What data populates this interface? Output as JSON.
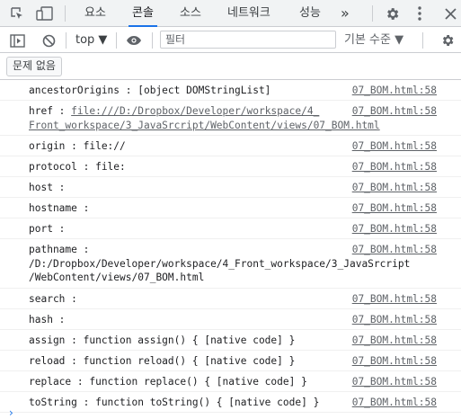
{
  "tabs": [
    {
      "label": "요소",
      "active": false
    },
    {
      "label": "콘솔",
      "active": true
    },
    {
      "label": "소스",
      "active": false
    },
    {
      "label": "네트워크",
      "active": false
    },
    {
      "label": "성능",
      "active": false
    }
  ],
  "toolbar": {
    "more_tabs": "»",
    "context": "top ▼",
    "filter_placeholder": "필터",
    "levels": "기본 수준 ▼"
  },
  "issues": {
    "label": "문제 없음"
  },
  "colors": {
    "accent": "#1a73e8",
    "link": "#5f6368"
  },
  "icons": [
    "inspect-icon",
    "device-toolbar-icon",
    "settings-icon",
    "kebab-menu-icon",
    "close-icon",
    "sidebar-toggle-icon",
    "clear-console-icon",
    "eye-icon",
    "gear-icon"
  ],
  "console": [
    {
      "lines": [
        "ancestorOrigins : [object DOMStringList]"
      ],
      "src": "07_BOM.html:58"
    },
    {
      "lines": [
        "href : ",
        "file:///D:/Dropbox/Developer/workspace/4_",
        "Front_workspace/3_JavaSrcript/WebContent/views/07_BOM.html"
      ],
      "src": "07_BOM.html:58"
    },
    {
      "lines": [
        "origin : file://"
      ],
      "src": "07_BOM.html:58"
    },
    {
      "lines": [
        "protocol : file:"
      ],
      "src": "07_BOM.html:58"
    },
    {
      "lines": [
        "host : "
      ],
      "src": "07_BOM.html:58"
    },
    {
      "lines": [
        "hostname : "
      ],
      "src": "07_BOM.html:58"
    },
    {
      "lines": [
        "port : "
      ],
      "src": "07_BOM.html:58"
    },
    {
      "lines": [
        "pathname : ",
        "/D:/Dropbox/Developer/workspace/4_Front_workspace/3_JavaSrcript",
        "/WebContent/views/07_BOM.html"
      ],
      "src": "07_BOM.html:58"
    },
    {
      "lines": [
        "search : "
      ],
      "src": "07_BOM.html:58"
    },
    {
      "lines": [
        "hash : "
      ],
      "src": "07_BOM.html:58"
    },
    {
      "lines": [
        "assign : function assign() { [native code] }"
      ],
      "src": "07_BOM.html:58"
    },
    {
      "lines": [
        "reload : function reload() { [native code] }"
      ],
      "src": "07_BOM.html:58"
    },
    {
      "lines": [
        "replace : function replace() { [native code] }"
      ],
      "src": "07_BOM.html:58"
    },
    {
      "lines": [
        "toString : function toString() { [native code] }"
      ],
      "src": "07_BOM.html:58"
    }
  ],
  "prompt": "›"
}
